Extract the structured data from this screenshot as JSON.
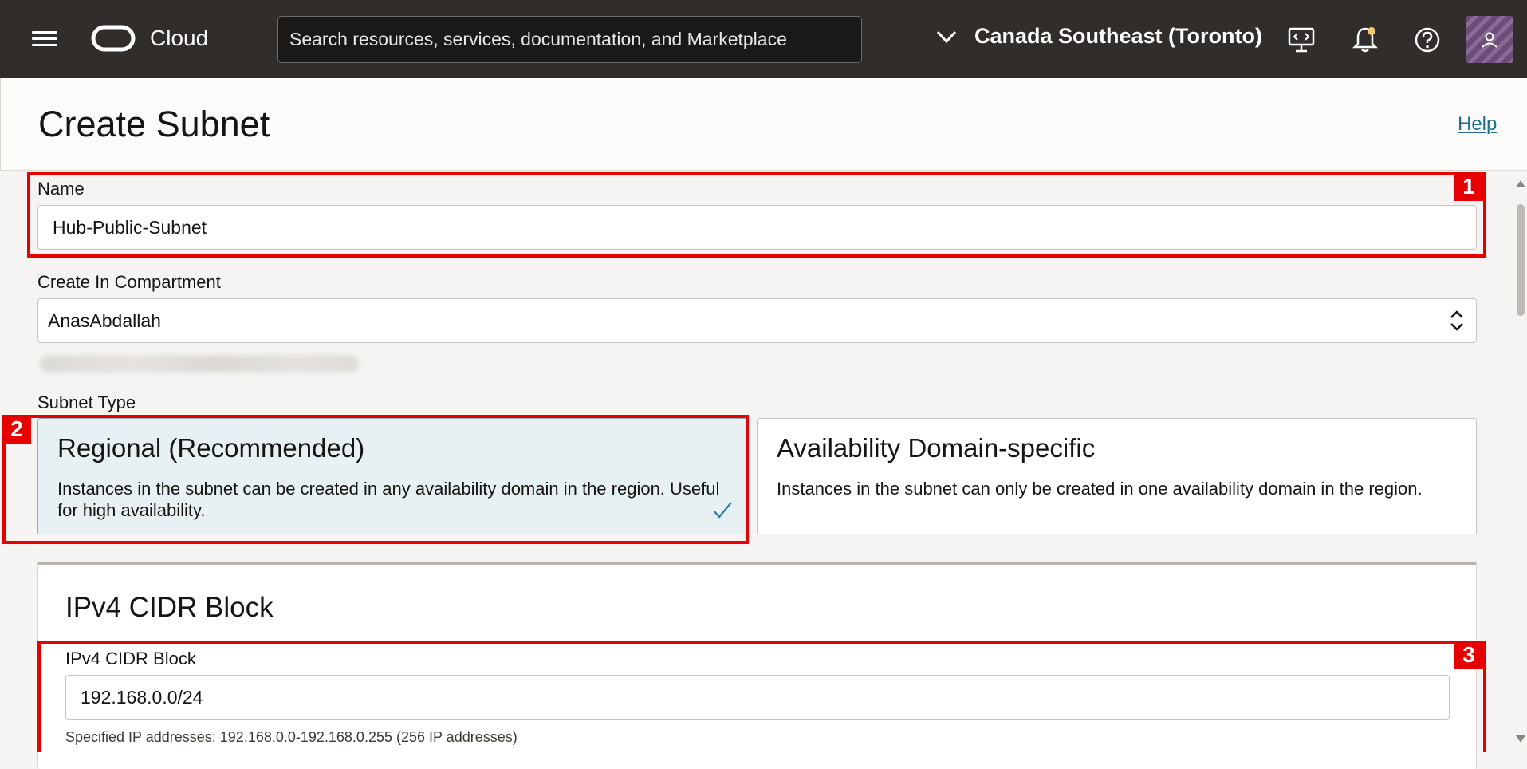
{
  "topbar": {
    "brand": "Cloud",
    "search_placeholder": "Search resources, services, documentation, and Marketplace",
    "region": "Canada Southeast (Toronto)"
  },
  "header": {
    "title": "Create Subnet",
    "help": "Help"
  },
  "form": {
    "name_label": "Name",
    "name_value": "Hub-Public-Subnet",
    "compartment_label": "Create In Compartment",
    "compartment_value": "AnasAbdallah",
    "subnet_type_label": "Subnet Type",
    "subnet_types": [
      {
        "title": "Regional (Recommended)",
        "description": "Instances in the subnet can be created in any availability domain in the region. Useful for high availability.",
        "selected": true
      },
      {
        "title": "Availability Domain-specific",
        "description": "Instances in the subnet can only be created in one availability domain in the region.",
        "selected": false
      }
    ],
    "cidr_section_title": "IPv4 CIDR Block",
    "cidr_label": "IPv4 CIDR Block",
    "cidr_value": "192.168.0.0/24",
    "cidr_hint": "Specified IP addresses: 192.168.0.0-192.168.0.255 (256 IP addresses)"
  },
  "annotations": [
    "1",
    "2",
    "3"
  ],
  "colors": {
    "topbar": "#312d2a",
    "annotation": "#e60000",
    "selected_card": "#e7f1f4",
    "link": "#1f6f8b"
  }
}
